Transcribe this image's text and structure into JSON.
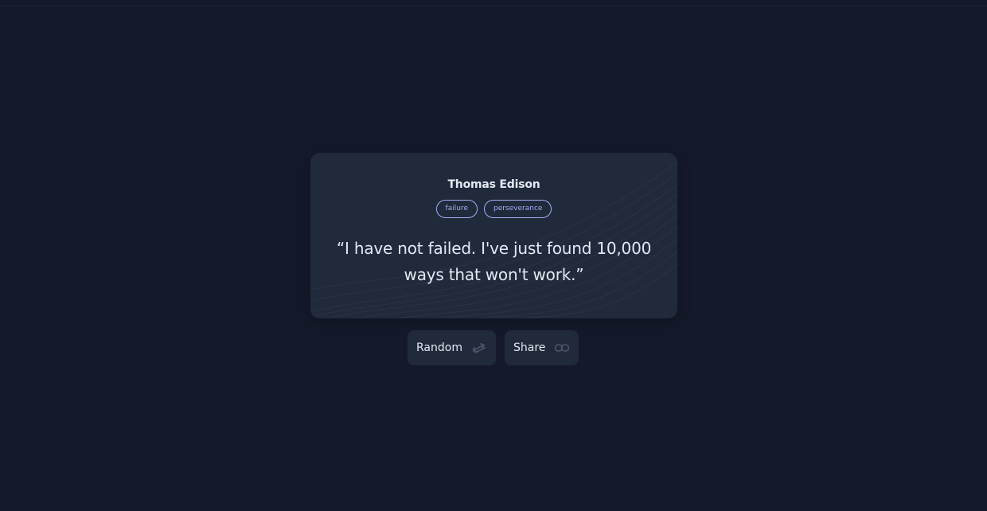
{
  "quote_card": {
    "author": "Thomas Edison",
    "tags": [
      {
        "label": "failure"
      },
      {
        "label": "perseverance"
      }
    ],
    "quote": "“I have not failed. I've just found 10,000 ways that won't work.”"
  },
  "actions": {
    "random_label": "Random",
    "random_icon": "shuffle-arrows-icon",
    "share_label": "Share",
    "share_icon": "link-icon"
  },
  "colors": {
    "background": "#141a2a",
    "card": "#212a3b",
    "text": "#e3e8f3",
    "tag_accent": "#a3adf2",
    "icon_muted": "#4b556a"
  }
}
